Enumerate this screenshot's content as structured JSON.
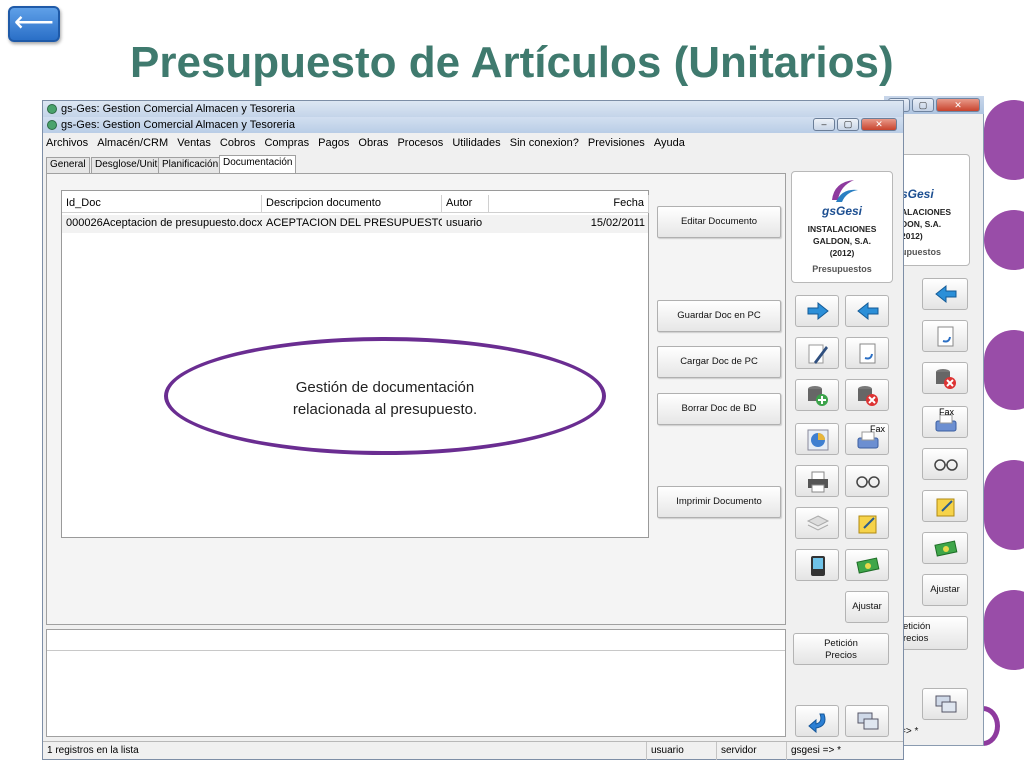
{
  "slide": {
    "title": "Presupuesto de Artículos (Unitarios)",
    "back_button_glyph": "⟵",
    "accent_color": "#8e3a9e",
    "title_color": "#3f7a6e"
  },
  "window": {
    "title_1": "gs-Ges: Gestion Comercial Almacen y Tesoreria",
    "title_2": "gs-Ges: Gestion Comercial Almacen y Tesoreria",
    "controls": {
      "minimize": "–",
      "maximize": "▢",
      "close": "✕"
    }
  },
  "menu": [
    "Archivos",
    "Almacén/CRM",
    "Ventas",
    "Cobros",
    "Compras",
    "Pagos",
    "Obras",
    "Procesos",
    "Utilidades",
    "Sin conexion?",
    "Previsiones",
    "Ayuda"
  ],
  "tabs": [
    {
      "label": "General",
      "active": false
    },
    {
      "label": "Desglose/Unit",
      "active": false
    },
    {
      "label": "Planificación",
      "active": false
    },
    {
      "label": "Documentación",
      "active": true
    }
  ],
  "grid": {
    "headers": [
      "Id_Doc",
      "Descripcion documento",
      "Autor",
      "Fecha"
    ],
    "rows": [
      [
        "000026Aceptacion de presupuesto.docx",
        "ACEPTACION DEL PRESUPUESTO",
        "usuario",
        "15/02/2011"
      ]
    ]
  },
  "callout": {
    "line1": "Gestión de documentación",
    "line2": "relacionada al presupuesto."
  },
  "actions": {
    "edit": "Editar Documento",
    "save_pc": "Guardar Doc en PC",
    "load_pc": "Cargar Doc de PC",
    "delete_bd": "Borrar Doc de BD",
    "print": "Imprimir Documento"
  },
  "logo": {
    "name": "gsGesi",
    "line1": "INSTALACIONES",
    "line2": "GALDON, S.A.",
    "line3": "(2012)",
    "subtitle": "Presupuestos"
  },
  "side_buttons": {
    "ajustar": "Ajustar",
    "peticion_1": "Petición",
    "peticion_2": "Precios",
    "fax": "Fax"
  },
  "status": {
    "records": "1 registros en la lista",
    "user": "usuario",
    "server": "servidor",
    "db": "gsgesi => *"
  },
  "back_window": {
    "logo_name": "sGesi",
    "line1": "ALACIONES",
    "line2": "DON, S.A.",
    "line3": "2012)",
    "subtitle": "upuestos",
    "ajustar": "Ajustar",
    "peticion_1": "etición",
    "peticion_2": "recios",
    "fax": "Fax",
    "status_tail": "=> *"
  },
  "icons": {
    "forward": "arrow-right-icon",
    "backward": "arrow-left-icon",
    "edit": "pen-icon",
    "undo_doc": "document-undo-icon",
    "db_add": "database-add-icon",
    "db_delete": "database-delete-icon",
    "chart": "pie-chart-icon",
    "fax": "fax-icon",
    "print": "printer-icon",
    "glasses": "glasses-icon",
    "layers": "layers-icon",
    "notes": "notes-icon",
    "pda": "pda-icon",
    "money": "money-icon",
    "refresh": "refresh-arrow-icon",
    "multi_window": "windows-icon"
  }
}
